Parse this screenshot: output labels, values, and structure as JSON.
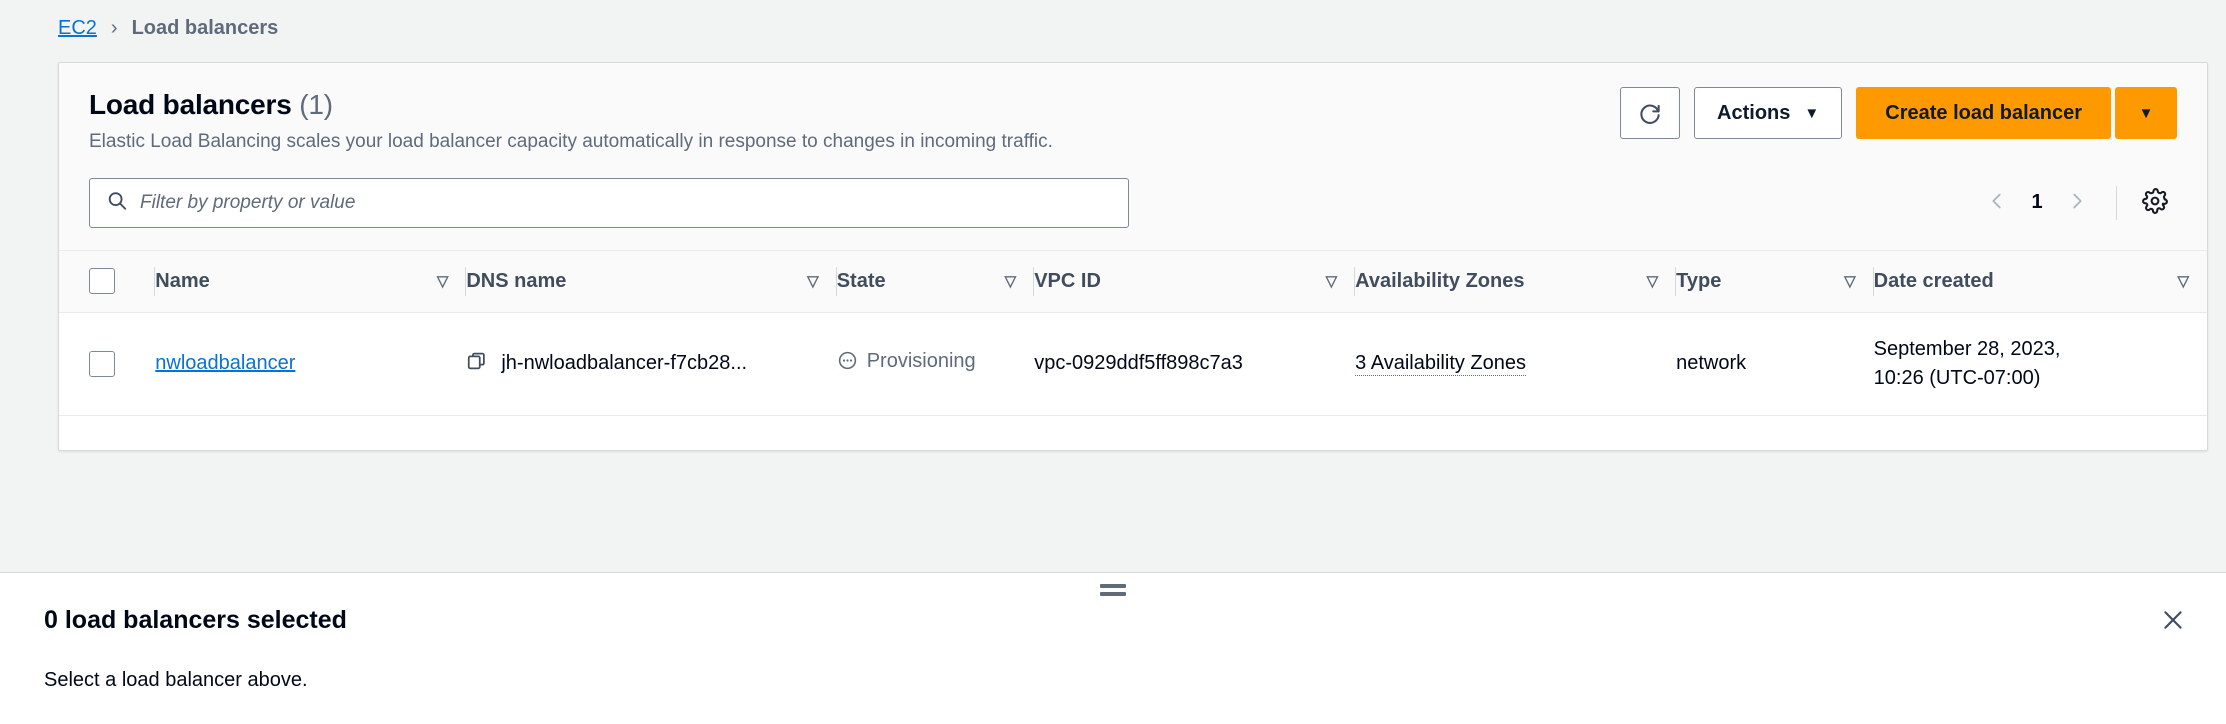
{
  "breadcrumb": {
    "root_label": "EC2",
    "separator": "›",
    "current_label": "Load balancers"
  },
  "card": {
    "title": "Load balancers",
    "count": "(1)",
    "description": "Elastic Load Balancing scales your load balancer capacity automatically in response to changes in incoming traffic."
  },
  "toolbar": {
    "refresh_icon": "refresh-icon",
    "actions_label": "Actions",
    "actions_caret": "▼",
    "create_label": "Create load balancer",
    "create_caret": "▼"
  },
  "filter": {
    "placeholder": "Filter by property or value",
    "value": "",
    "search_icon": "search-icon"
  },
  "pagination": {
    "prev_icon": "chevron-left-icon",
    "page": "1",
    "next_icon": "chevron-right-icon",
    "settings_icon": "gear-icon"
  },
  "table": {
    "columns": [
      {
        "label": "Name",
        "sort_icon": "▽"
      },
      {
        "label": "DNS name",
        "sort_icon": "▽"
      },
      {
        "label": "State",
        "sort_icon": "▽"
      },
      {
        "label": "VPC ID",
        "sort_icon": "▽"
      },
      {
        "label": "Availability Zones",
        "sort_icon": "▽"
      },
      {
        "label": "Type",
        "sort_icon": "▽"
      },
      {
        "label": "Date created",
        "sort_icon": "▽"
      }
    ],
    "rows": [
      {
        "name": "nwloadbalancer",
        "dns_name": "jh-nwloadbalancer-f7cb28...",
        "dns_copy_icon": "copy-icon",
        "state": "Provisioning",
        "state_icon": "pending-icon",
        "vpc_id": "vpc-0929ddf5ff898c7a3",
        "availability_zones": "3 Availability Zones",
        "type": "network",
        "date_created_line1": "September 28, 2023,",
        "date_created_line2": "10:26 (UTC-07:00)"
      }
    ]
  },
  "split_panel": {
    "drag_handle_icon": "drag-handle-icon",
    "title": "0 load balancers selected",
    "close_icon": "close-icon",
    "body_text": "Select a load balancer above."
  },
  "colors": {
    "accent_orange": "#ff9900",
    "link_blue": "#0972d3",
    "page_background": "#f2f3f3",
    "card_header_background": "#fafafa",
    "muted_text": "#5f6b7a"
  }
}
